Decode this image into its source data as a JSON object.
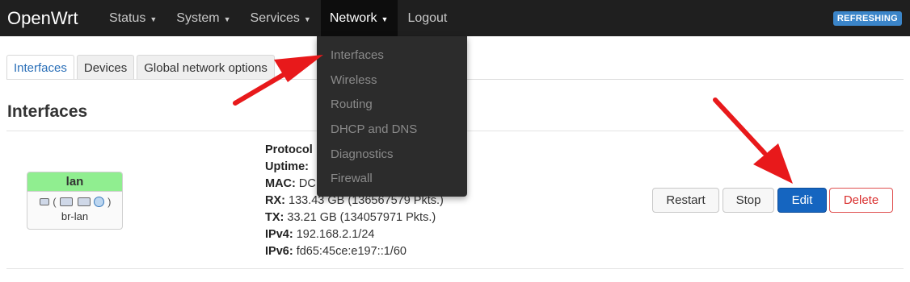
{
  "navbar": {
    "brand": "OpenWrt",
    "items": [
      {
        "label": "Status",
        "caret": "▼"
      },
      {
        "label": "System",
        "caret": "▼"
      },
      {
        "label": "Services",
        "caret": "▼"
      },
      {
        "label": "Network",
        "caret": "▼"
      },
      {
        "label": "Logout"
      }
    ],
    "badge": "REFRESHING"
  },
  "tabs": [
    {
      "label": "Interfaces"
    },
    {
      "label": "Devices"
    },
    {
      "label": "Global network options"
    }
  ],
  "heading": "Interfaces",
  "network_menu": [
    {
      "label": "Interfaces"
    },
    {
      "label": "Wireless"
    },
    {
      "label": "Routing"
    },
    {
      "label": "DHCP and DNS"
    },
    {
      "label": "Diagnostics"
    },
    {
      "label": "Firewall"
    }
  ],
  "interface": {
    "name": "lan",
    "device": "br-lan",
    "color": "#90ee90",
    "status": [
      {
        "key": "Protocol",
        "value": ""
      },
      {
        "key": "Uptime:",
        "value": ""
      },
      {
        "key": "MAC:",
        "value": "DC"
      },
      {
        "key": "RX:",
        "value": "133.43 GB (136567579 Pkts.)"
      },
      {
        "key": "TX:",
        "value": "33.21 GB (134057971 Pkts.)"
      },
      {
        "key": "IPv4:",
        "value": "192.168.2.1/24"
      },
      {
        "key": "IPv6:",
        "value": "fd65:45ce:e197::1/60"
      }
    ]
  },
  "buttons": {
    "restart": "Restart",
    "stop": "Stop",
    "edit": "Edit",
    "delete": "Delete"
  },
  "colors": {
    "accent": "#1565c0",
    "navbar": "#1f1f1f",
    "badge": "#3b85c9",
    "danger": "#d9302f",
    "annotation_arrow": "#e8191b"
  }
}
